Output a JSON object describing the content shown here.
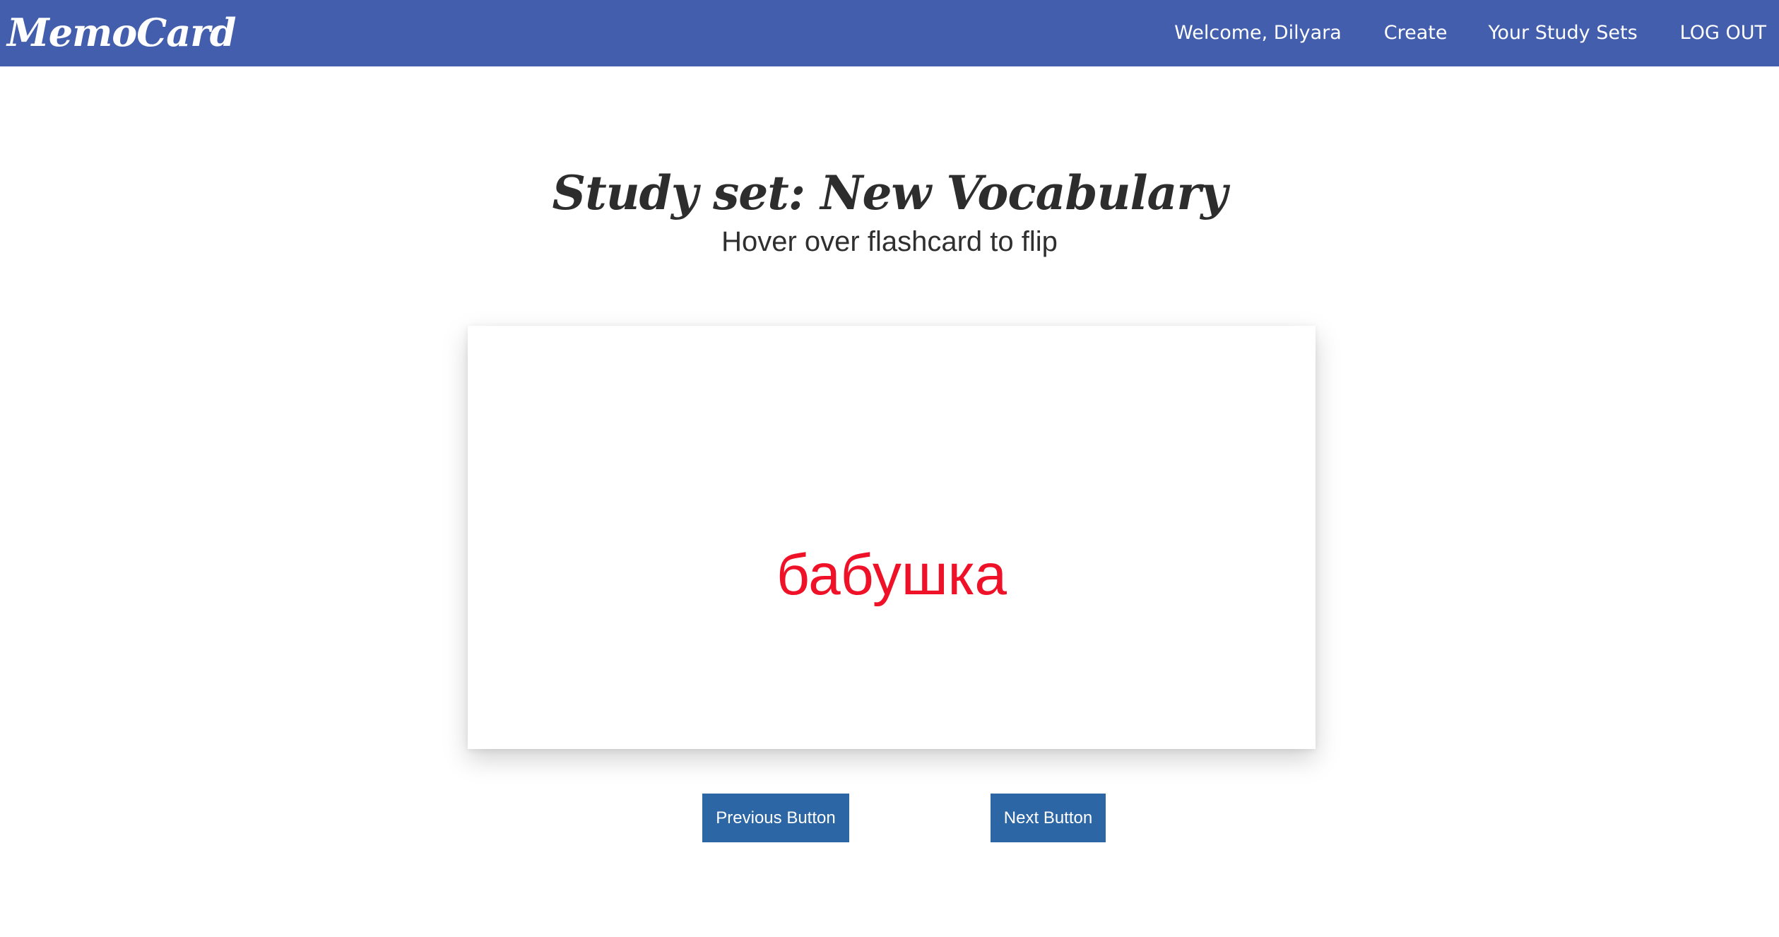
{
  "navbar": {
    "brand": "MemoCard",
    "links": [
      {
        "label": "Welcome, Dilyara"
      },
      {
        "label": "Create"
      },
      {
        "label": "Your Study Sets"
      },
      {
        "label": "LOG OUT"
      }
    ],
    "background_color": "#435ead"
  },
  "page": {
    "title": "Study set: New Vocabulary",
    "instruction": "Hover over flashcard to flip"
  },
  "flashcard": {
    "term": "бабушка",
    "term_color": "#ef1127"
  },
  "controls": {
    "previous_label": "Previous Button",
    "next_label": "Next Button",
    "button_color": "#2d66a4"
  }
}
